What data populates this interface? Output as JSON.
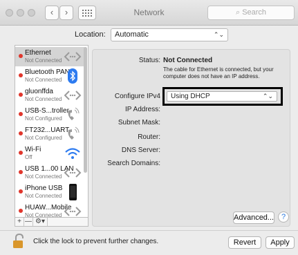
{
  "window": {
    "title": "Network",
    "search_placeholder": "Search"
  },
  "location": {
    "label": "Location:",
    "value": "Automatic"
  },
  "services": [
    {
      "name": "Ethernet",
      "status": "Not Connected",
      "color": "#e0362c",
      "icon": "ethernet-icon"
    },
    {
      "name": "Bluetooth PAN",
      "status": "Not Connected",
      "color": "#e0362c",
      "icon": "bluetooth-icon"
    },
    {
      "name": "gluonffda",
      "status": "Not Connected",
      "color": "#e0362c",
      "icon": "ethernet-icon"
    },
    {
      "name": "USB-S...troller",
      "status": "Not Configured",
      "color": "#e0362c",
      "icon": "modem-icon"
    },
    {
      "name": "FT232...UART",
      "status": "Not Configured",
      "color": "#e0362c",
      "icon": "modem-icon"
    },
    {
      "name": "Wi-Fi",
      "status": "Off",
      "color": "#e0362c",
      "icon": "wifi-icon"
    },
    {
      "name": "USB 1...00 LAN",
      "status": "Not Connected",
      "color": "#e0362c",
      "icon": "ethernet-icon"
    },
    {
      "name": "iPhone USB",
      "status": "Not Connected",
      "color": "#e0362c",
      "icon": "iphone-icon"
    },
    {
      "name": "HUAW...Mobile",
      "status": "Not Connected",
      "color": "#e0362c",
      "icon": "ethernet-icon"
    }
  ],
  "sidebar_tools": {
    "add": "+",
    "remove": "—",
    "action": "⚙▾"
  },
  "details": {
    "status_label": "Status:",
    "status_value": "Not Connected",
    "status_description": "The cable for Ethernet is connected, but your computer does not have an IP address.",
    "configure_label": "Configure IPv4",
    "configure_value": "Using DHCP",
    "ip_label": "IP Address:",
    "subnet_label": "Subnet Mask:",
    "router_label": "Router:",
    "dns_label": "DNS Server:",
    "search_domains_label": "Search Domains:"
  },
  "buttons": {
    "advanced": "Advanced...",
    "help": "?",
    "revert": "Revert",
    "apply": "Apply"
  },
  "lock_text": "Click the lock to prevent further changes."
}
